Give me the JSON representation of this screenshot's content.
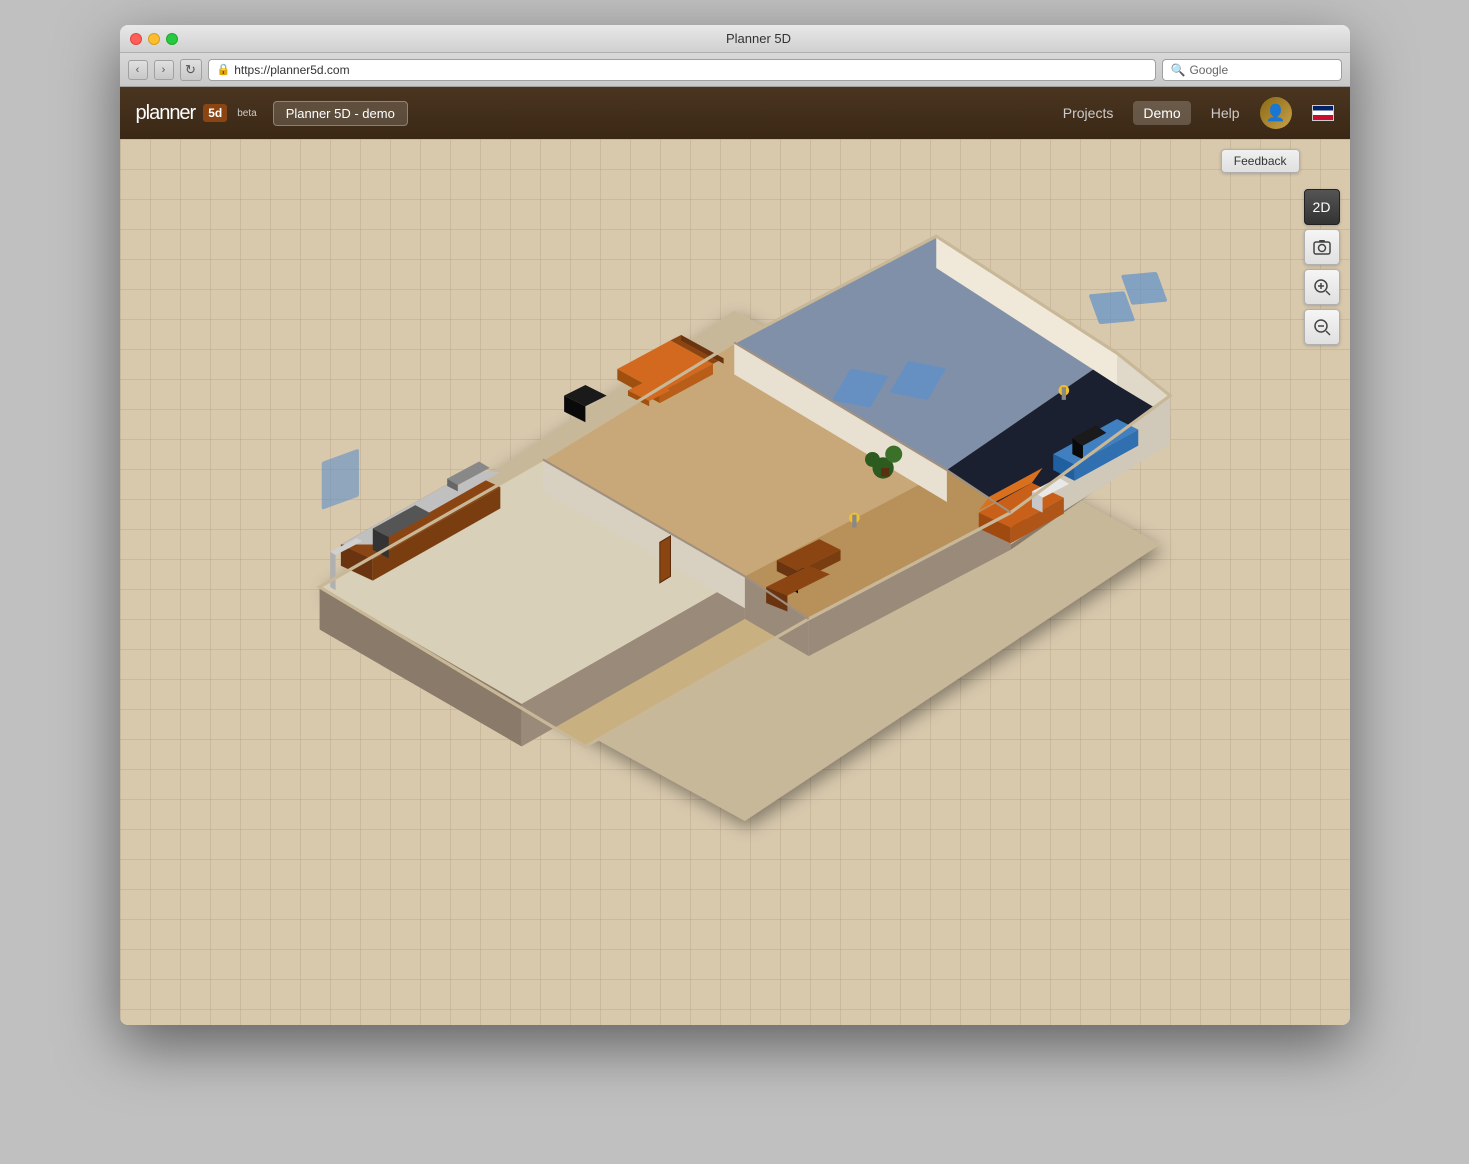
{
  "window": {
    "title": "Planner 5D",
    "traffic_lights": [
      "close",
      "minimize",
      "maximize"
    ]
  },
  "browser": {
    "url": "https://planner5d.com",
    "url_icon": "🔒",
    "search_placeholder": "Google",
    "back_label": "‹",
    "forward_label": "›",
    "reload_label": "↻"
  },
  "header": {
    "logo_text": "planner",
    "logo_box": "5d",
    "beta_label": "beta",
    "project_name": "Planner 5D - demo",
    "nav_items": [
      {
        "label": "Projects",
        "active": false
      },
      {
        "label": "Demo",
        "active": true
      },
      {
        "label": "Help",
        "active": false
      }
    ],
    "flag": "UK"
  },
  "toolbar": {
    "feedback_label": "Feedback",
    "buttons": [
      {
        "id": "2d",
        "label": "2D",
        "active": false
      },
      {
        "id": "screenshot",
        "label": "📷",
        "active": false
      },
      {
        "id": "zoom-in",
        "label": "🔍+",
        "active": false
      },
      {
        "id": "zoom-out",
        "label": "🔍-",
        "active": false
      }
    ]
  },
  "canvas": {
    "background_color": "#d8c9ad",
    "grid_color": "rgba(180,160,130,0.4)"
  }
}
